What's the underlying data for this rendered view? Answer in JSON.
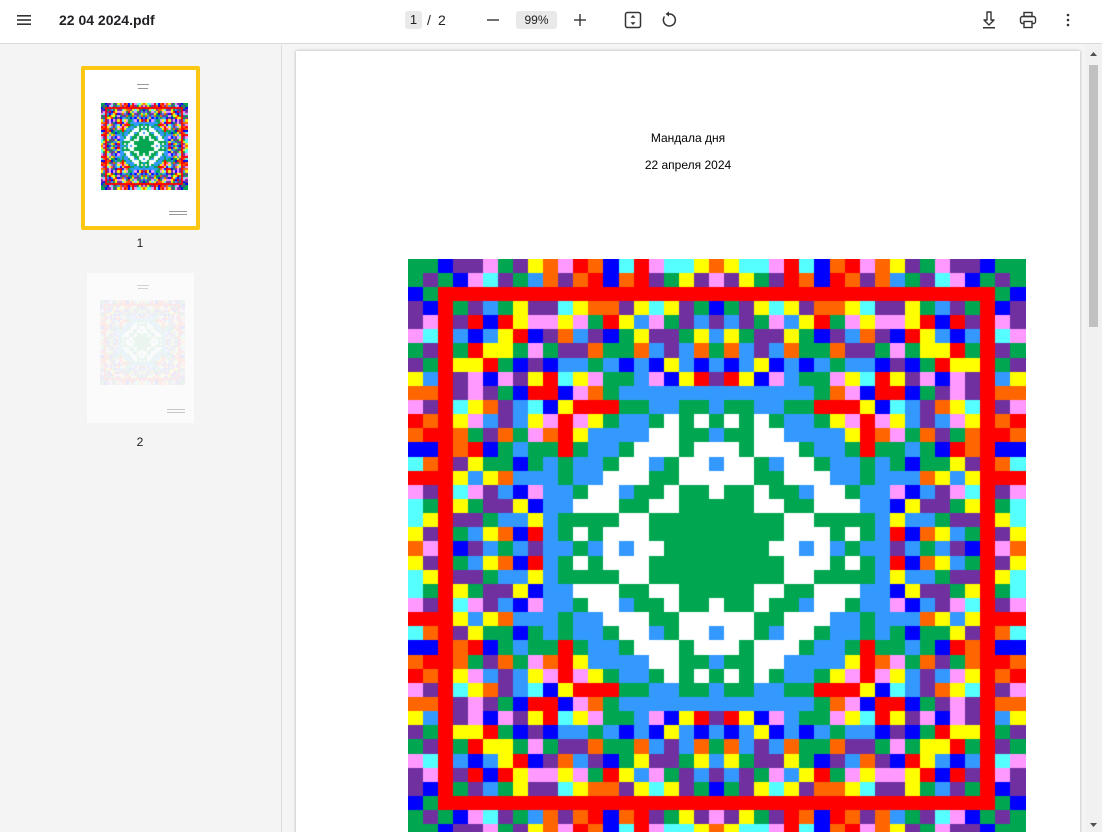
{
  "toolbar": {
    "menu_icon": "hamburger-menu-icon",
    "file_name": "22 04 2024.pdf",
    "current_page": "1",
    "page_separator": "/",
    "total_pages": "2",
    "zoom": "99%",
    "icons": [
      "zoom-out-icon",
      "zoom-in-icon",
      "fit-page-icon",
      "rotate-icon",
      "download-icon",
      "print-icon",
      "more-options-icon"
    ]
  },
  "sidebar": {
    "thumbnails": [
      {
        "label": "1",
        "selected": true
      },
      {
        "label": "2",
        "selected": false
      }
    ]
  },
  "document": {
    "title": "Мандала дня",
    "date": "22 апреля 2024"
  },
  "colors": {
    "accent_selection": "#fbc711",
    "mandala_palette": [
      "#ff0000",
      "#00a650",
      "#3399ff",
      "#ffff00",
      "#55ffff",
      "#ff99ff",
      "#0000ff",
      "#7030a0",
      "#ff6600",
      "#ffffff"
    ]
  }
}
